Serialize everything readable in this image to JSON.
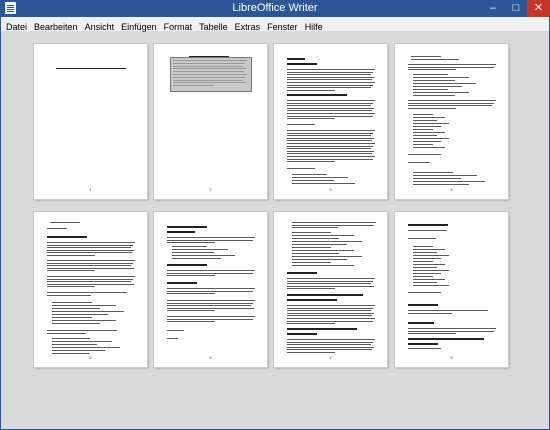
{
  "window": {
    "title": "LibreOffice Writer",
    "minimize": "–",
    "maximize": "□",
    "close": "✕"
  },
  "menu": [
    "Datei",
    "Bearbeiten",
    "Ansicht",
    "Einfügen",
    "Format",
    "Tabelle",
    "Extras",
    "Fenster",
    "Hilfe"
  ],
  "pages": [
    {
      "number": "1"
    },
    {
      "number": "2"
    },
    {
      "number": "3"
    },
    {
      "number": "4"
    },
    {
      "number": "5"
    },
    {
      "number": "6"
    },
    {
      "number": "7"
    },
    {
      "number": "8"
    }
  ],
  "colors": {
    "titlebar": "#2b579a",
    "close_button": "#c7352a",
    "workspace": "#d9d9d9",
    "menubar": "#f0f0f0"
  },
  "icons": [
    "writer-app-icon",
    "minimize-icon",
    "maximize-icon",
    "close-icon"
  ]
}
